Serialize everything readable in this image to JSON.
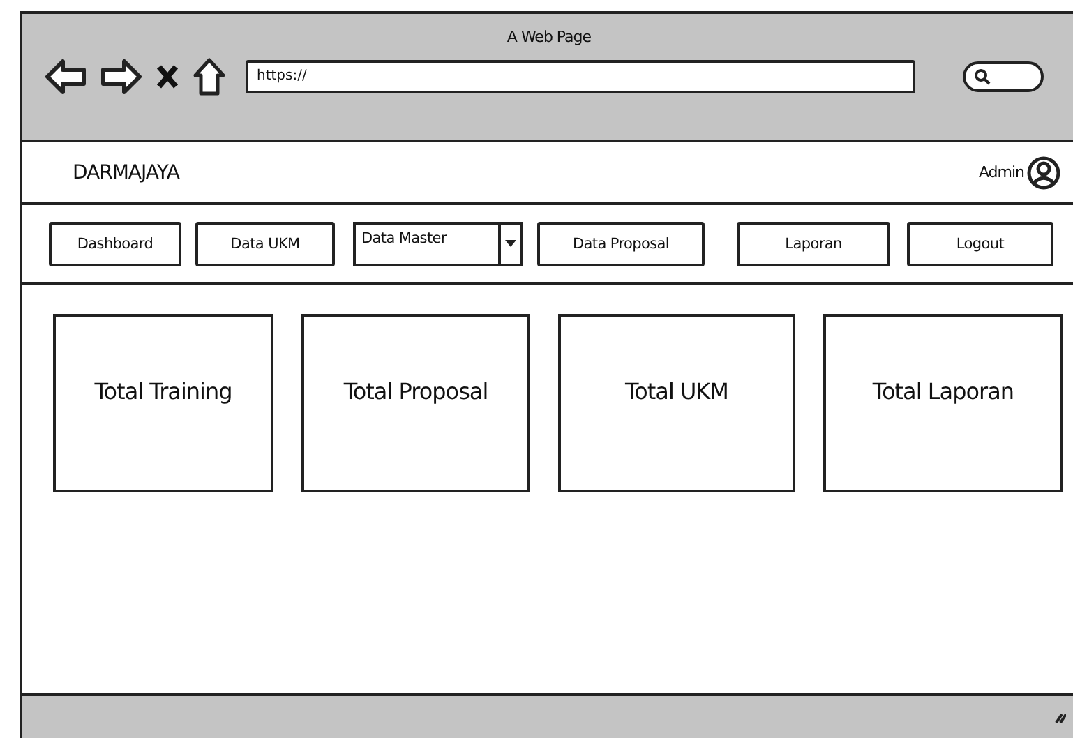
{
  "window": {
    "title": "A Web Page"
  },
  "browser": {
    "url": "https://"
  },
  "header": {
    "brand": "DARMAJAYA",
    "user": "Admin"
  },
  "nav": [
    {
      "label": "Dashboard",
      "kind": "button"
    },
    {
      "label": "Data UKM",
      "kind": "button"
    },
    {
      "label": "Data Master",
      "kind": "dropdown"
    },
    {
      "label": "Data Proposal",
      "kind": "button"
    },
    {
      "label": "Laporan",
      "kind": "button"
    },
    {
      "label": "Logout",
      "kind": "button"
    }
  ],
  "cards": [
    {
      "title": "Total Training"
    },
    {
      "title": "Total Proposal"
    },
    {
      "title": "Total UKM"
    },
    {
      "title": "Total Laporan"
    }
  ]
}
